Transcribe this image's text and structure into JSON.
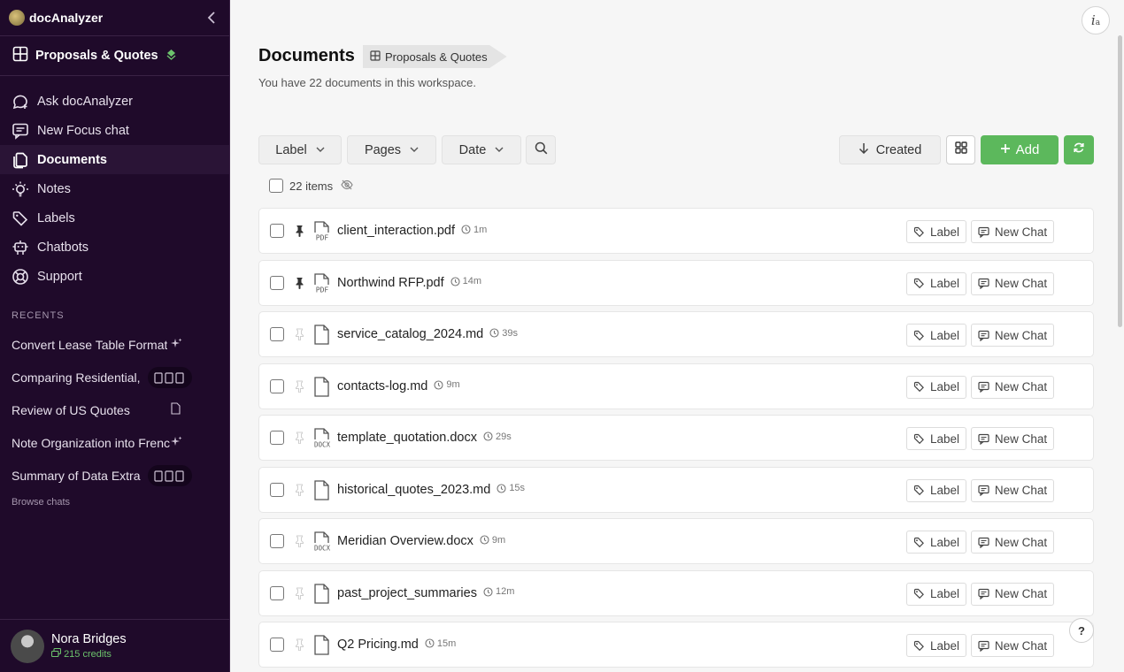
{
  "app": {
    "name": "docAnalyzer"
  },
  "workspace": {
    "name": "Proposals & Quotes"
  },
  "nav": [
    {
      "label": "Ask docAnalyzer",
      "icon": "chat-plus-icon",
      "active": false
    },
    {
      "label": "New Focus chat",
      "icon": "focus-chat-icon",
      "active": false
    },
    {
      "label": "Documents",
      "icon": "documents-icon",
      "active": true
    },
    {
      "label": "Notes",
      "icon": "lightbulb-icon",
      "active": false
    },
    {
      "label": "Labels",
      "icon": "tag-icon",
      "active": false
    },
    {
      "label": "Chatbots",
      "icon": "robot-icon",
      "active": false
    },
    {
      "label": "Support",
      "icon": "lifebuoy-icon",
      "active": false
    }
  ],
  "recents": {
    "title": "RECENTS",
    "items": [
      {
        "label": "Convert Lease Table Format",
        "badge": ""
      },
      {
        "label": "Comparing Residential,",
        "badge": "multi-doc"
      },
      {
        "label": "Review of US Quotes",
        "badge": ""
      },
      {
        "label": "Note Organization into Frenc",
        "badge": ""
      },
      {
        "label": "Summary of Data Extra",
        "badge": "multi-doc"
      }
    ],
    "browse_label": "Browse chats"
  },
  "user": {
    "name": "Nora Bridges",
    "credits": "215 credits"
  },
  "header": {
    "title": "Documents",
    "workspace_tag": "Proposals & Quotes",
    "subtitle": "You have 22 documents in this workspace."
  },
  "toolbar": {
    "label_filter": "Label",
    "pages_filter": "Pages",
    "date_filter": "Date",
    "sort_label": "Created",
    "add_label": "Add"
  },
  "list": {
    "items_count": "22 items",
    "label_btn": "Label",
    "chat_btn": "New Chat",
    "rows": [
      {
        "name": "client_interaction.pdf",
        "time": "1m",
        "type": "pdf",
        "pinned": true
      },
      {
        "name": "Northwind RFP.pdf",
        "time": "14m",
        "type": "pdf",
        "pinned": true
      },
      {
        "name": "service_catalog_2024.md",
        "time": "39s",
        "type": "md",
        "pinned": false
      },
      {
        "name": "contacts-log.md",
        "time": "9m",
        "type": "md",
        "pinned": false
      },
      {
        "name": "template_quotation.docx",
        "time": "29s",
        "type": "docx",
        "pinned": false
      },
      {
        "name": "historical_quotes_2023.md",
        "time": "15s",
        "type": "md",
        "pinned": false
      },
      {
        "name": "Meridian Overview.docx",
        "time": "9m",
        "type": "docx",
        "pinned": false
      },
      {
        "name": "past_project_summaries",
        "time": "12m",
        "type": "md",
        "pinned": false
      },
      {
        "name": "Q2 Pricing.md",
        "time": "15m",
        "type": "md",
        "pinned": false
      }
    ]
  },
  "colors": {
    "sidebar_bg": "#1f0a2a",
    "accent_green": "#5cb85c"
  }
}
